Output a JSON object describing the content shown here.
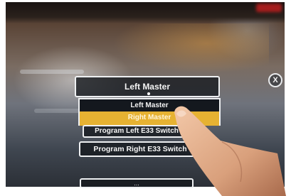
{
  "selector": {
    "value": "Left Master"
  },
  "dropdown": {
    "options": [
      "Left Master",
      "Right Master"
    ],
    "highlighted": "Right Master"
  },
  "buttons": {
    "program_left_e33": "Program Left E33 Switch",
    "program_right_e33": "Program Right E33 Switch",
    "bottom_partial": "..."
  },
  "close": {
    "glyph": "X"
  },
  "colors": {
    "highlight": "#e6b232",
    "box_border": "#eef0f2",
    "box_fill": "#14181e"
  },
  "icons": {
    "close": "close-icon"
  }
}
